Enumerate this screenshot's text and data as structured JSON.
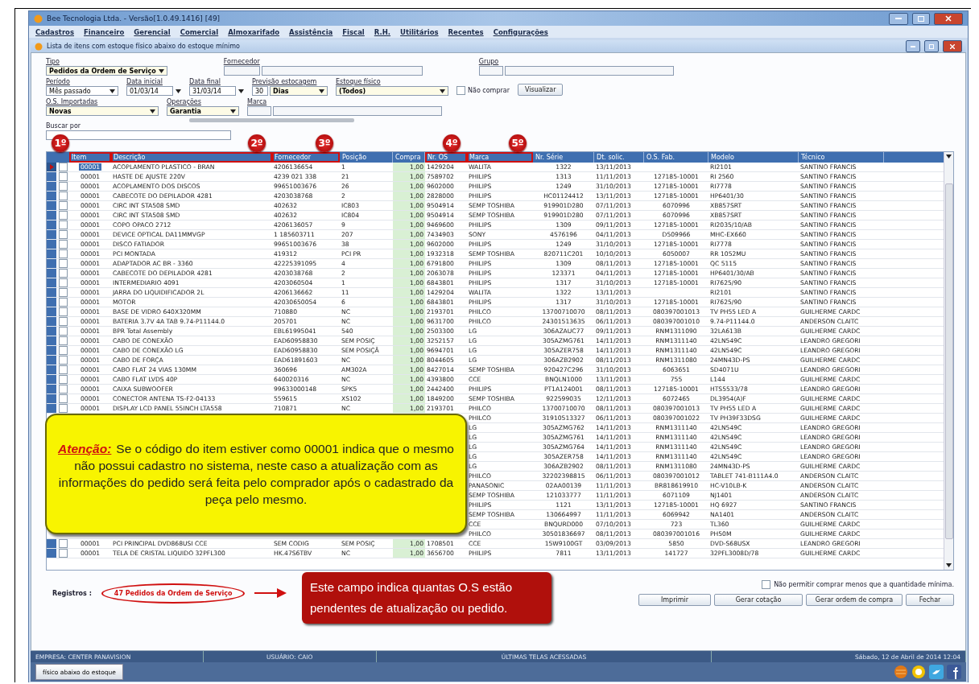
{
  "window": {
    "title": "Bee Tecnologia Ltda. - Versão[1.0.49.1416] [49]"
  },
  "menu": [
    "Cadastros",
    "Financeiro",
    "Gerencial",
    "Comercial",
    "Almoxarifado",
    "Assistência",
    "Fiscal",
    "R.H.",
    "Utilitários",
    "Recentes",
    "Configurações"
  ],
  "document": {
    "title": "Lista de itens com estoque físico abaixo do estoque mínimo"
  },
  "filter_rows": [
    [
      {
        "kind": "dropdown",
        "label": "Tipo",
        "value": "Pedidos da Ordem de Serviço",
        "highlighted": true
      },
      {
        "kind": "lookup",
        "label": "Fornecedor"
      },
      {
        "kind": "lookup",
        "label": "Grupo"
      }
    ],
    [
      {
        "kind": "dropdown",
        "label": "Período",
        "value": "Mês passado",
        "highlighted": false
      },
      {
        "kind": "date",
        "label": "Data inicial",
        "value": "01/03/14"
      },
      {
        "kind": "date",
        "label": "Data final",
        "value": "31/03/14"
      },
      {
        "kind": "number_unit",
        "label": "Previsão estocagem",
        "value": "30",
        "unit": "Dias"
      },
      {
        "kind": "dropdown",
        "label": "Estoque físico",
        "value": "(Todos)",
        "highlighted": true
      },
      {
        "kind": "checkbox",
        "label": "Não comprar",
        "checked": false
      },
      {
        "kind": "button",
        "label": "Visualizar"
      }
    ],
    [
      {
        "kind": "dropdown",
        "label": "O.S. Importadas",
        "value": "Novas",
        "highlighted": true
      },
      {
        "kind": "dropdown",
        "label": "Operações",
        "value": "Garantia",
        "highlighted": true
      },
      {
        "kind": "lookup",
        "label": "Marca"
      }
    ]
  ],
  "search": {
    "label": "Buscar por"
  },
  "table": {
    "columns": [
      {
        "label": "Item",
        "marker": "1º"
      },
      {
        "label": "Descrição",
        "marker": "2º"
      },
      {
        "label": "Fornecedor",
        "marker": "3º"
      },
      {
        "label": "Posição"
      },
      {
        "label": "Compra"
      },
      {
        "label": "Nr. OS",
        "marker": "4º"
      },
      {
        "label": "Marca",
        "marker": "5º"
      },
      {
        "label": "Nr. Série"
      },
      {
        "label": "Dt. solic."
      },
      {
        "label": "O.S. Fab."
      },
      {
        "label": "Modelo"
      },
      {
        "label": "Técnico"
      }
    ],
    "rows": [
      {
        "selected": true,
        "checked": false,
        "cells": [
          "00001",
          "ACOPLAMENTO PLASTICO - BRAN",
          "4206136654",
          "1",
          "1,00",
          "1429204",
          "WALITA",
          "1322",
          "13/11/2013",
          "",
          "RI2101",
          "SANTINO FRANCIS"
        ]
      },
      {
        "selected": false,
        "checked": false,
        "cells": [
          "00001",
          "HASTE DE AJUSTE 220V",
          "4239 021 338",
          "21",
          "1,00",
          "7589702",
          "PHILIPS",
          "1313",
          "11/11/2013",
          "127185-10001",
          "RI 2560",
          "SANTINO FRANCIS"
        ]
      },
      {
        "selected": false,
        "checked": false,
        "cells": [
          "00001",
          "ACOPLAMENTO DOS DISCOS",
          "99651003676",
          "26",
          "1,00",
          "9602000",
          "PHILIPS",
          "1249",
          "31/10/2013",
          "127185-10001",
          "RI7778",
          "SANTINO FRANCIS"
        ]
      },
      {
        "selected": false,
        "checked": false,
        "cells": [
          "00001",
          "CABECOTE DO DEPILADOR 4281",
          "4203038768",
          "2",
          "1,00",
          "2828000",
          "PHILIPS",
          "HC01124412",
          "13/11/2013",
          "127185-10001",
          "HP6401/30",
          "SANTINO FRANCIS"
        ]
      },
      {
        "selected": false,
        "checked": false,
        "cells": [
          "00001",
          "CIRC INT STA508 SMD",
          "402632",
          "IC803",
          "1,00",
          "9504914",
          "SEMP TOSHIBA",
          "919901D280",
          "07/11/2013",
          "6070996",
          "XB857SRT",
          "SANTINO FRANCIS"
        ]
      },
      {
        "selected": false,
        "checked": false,
        "cells": [
          "00001",
          "CIRC INT STA508 SMD",
          "402632",
          "IC804",
          "1,00",
          "9504914",
          "SEMP TOSHIBA",
          "919901D280",
          "07/11/2013",
          "6070996",
          "XB857SRT",
          "SANTINO FRANCIS"
        ]
      },
      {
        "selected": false,
        "checked": false,
        "cells": [
          "00001",
          "COPO OPACO 2712",
          "4206136057",
          "9",
          "1,00",
          "9469600",
          "PHILIPS",
          "1309",
          "09/11/2013",
          "127185-10001",
          "RI2035/10/AB",
          "SANTINO FRANCIS"
        ]
      },
      {
        "selected": false,
        "checked": false,
        "cells": [
          "00001",
          "DEVICE OPTICAL DA11MMVGP",
          "1 185603711",
          "207",
          "1,00",
          "7434903",
          "SONY",
          "4576196",
          "04/11/2013",
          "D509966",
          "MHC-EX660",
          "SANTINO FRANCIS"
        ]
      },
      {
        "selected": false,
        "checked": false,
        "cells": [
          "00001",
          "DISCO FATIADOR",
          "99651003676",
          "38",
          "1,00",
          "9602000",
          "PHILIPS",
          "1249",
          "31/10/2013",
          "127185-10001",
          "RI7778",
          "SANTINO FRANCIS"
        ]
      },
      {
        "selected": false,
        "checked": false,
        "cells": [
          "00001",
          "PCI MONTADA",
          "419312",
          "PCI PR",
          "1,00",
          "1932318",
          "SEMP TOSHIBA",
          "820711C201",
          "10/10/2013",
          "6050007",
          "RR 1052MU",
          "SANTINO FRANCIS"
        ]
      },
      {
        "selected": false,
        "checked": false,
        "cells": [
          "00001",
          "ADAPTADOR AC BR - 3360",
          "42225391095",
          "4",
          "1,00",
          "6791800",
          "PHILIPS",
          "1309",
          "08/11/2013",
          "127185-10001",
          "QC 5115",
          "SANTINO FRANCIS"
        ]
      },
      {
        "selected": false,
        "checked": false,
        "cells": [
          "00001",
          "CABECOTE DO DEPILADOR 4281",
          "4203038768",
          "2",
          "1,00",
          "2063078",
          "PHILIPS",
          "123371",
          "04/11/2013",
          "127185-10001",
          "HP6401/30/AB",
          "SANTINO FRANCIS"
        ]
      },
      {
        "selected": false,
        "checked": false,
        "cells": [
          "00001",
          "INTERMEDIARIO 4091",
          "4203060504",
          "1",
          "1,00",
          "6843801",
          "PHILIPS",
          "1317",
          "31/10/2013",
          "127185-10001",
          "RI7625/90",
          "SANTINO FRANCIS"
        ]
      },
      {
        "selected": false,
        "checked": false,
        "cells": [
          "00001",
          "JARRA DO LIQUIDIFICADOR 2L",
          "4206136662",
          "11",
          "1,00",
          "1429204",
          "WALITA",
          "1322",
          "13/11/2013",
          "",
          "RI2101",
          "SANTINO FRANCIS"
        ]
      },
      {
        "selected": false,
        "checked": false,
        "cells": [
          "00001",
          "MOTOR",
          "42030650054",
          "6",
          "1,00",
          "6843801",
          "PHILIPS",
          "1317",
          "31/10/2013",
          "127185-10001",
          "RI7625/90",
          "SANTINO FRANCIS"
        ]
      },
      {
        "selected": false,
        "checked": false,
        "cells": [
          "00001",
          "BASE DE VIDRO 640X320MM",
          "710880",
          "NC",
          "1,00",
          "2193701",
          "PHILCO",
          "13700710070",
          "08/11/2013",
          "080397001013",
          "TV PH55 LED A",
          "GUILHERME CARDC"
        ]
      },
      {
        "selected": false,
        "checked": false,
        "cells": [
          "00001",
          "BATERIA 3.7V 4A TAB 9.74-P11144.0",
          "205701",
          "NC",
          "1,00",
          "9631700",
          "PHILCO",
          "24301513635",
          "06/11/2013",
          "080397001010",
          "9.74-P11144.0",
          "ANDERSON CLAITC"
        ]
      },
      {
        "selected": false,
        "checked": false,
        "cells": [
          "00001",
          "BPR Total Assembly",
          "EBL61995041",
          "540",
          "1,00",
          "2503300",
          "LG",
          "306AZAUC77",
          "09/11/2013",
          "RNM1311090",
          "32LA613B",
          "GUILHERME CARDC"
        ]
      },
      {
        "selected": false,
        "checked": false,
        "cells": [
          "00001",
          "CABO DE CONEXÃO",
          "EAD60958830",
          "SEM POSIÇ",
          "1,00",
          "3252157",
          "LG",
          "305AZMG761",
          "14/11/2013",
          "RNM1311140",
          "42LN549C",
          "LEANDRO GREGORI"
        ]
      },
      {
        "selected": false,
        "checked": false,
        "cells": [
          "00001",
          "CABO DE CONEXÃO LG",
          "EAD60958830",
          "SEM POSIÇÃ",
          "1,00",
          "9694701",
          "LG",
          "305AZER758",
          "14/11/2013",
          "RNM1311140",
          "42LN549C",
          "LEANDRO GREGORI"
        ]
      },
      {
        "selected": false,
        "checked": false,
        "cells": [
          "00001",
          "CABO DE FORÇA",
          "EAD61891603",
          "NC",
          "1,00",
          "8044605",
          "LG",
          "306AZB2902",
          "08/11/2013",
          "RNM1311080",
          "24MN43D-PS",
          "GUILHERME CARDC"
        ]
      },
      {
        "selected": false,
        "checked": false,
        "cells": [
          "00001",
          "CABO FLAT 24 VIAS 130MM",
          "360696",
          "AM302A",
          "1,00",
          "8427014",
          "SEMP TOSHIBA",
          "920427C296",
          "31/10/2013",
          "6063651",
          "SD4071U",
          "LEANDRO GREGORI"
        ]
      },
      {
        "selected": false,
        "checked": false,
        "cells": [
          "00001",
          "CABO FLAT LVDS 40P",
          "640020316",
          "NC",
          "1,00",
          "4393800",
          "CCE",
          "BNQLN1000",
          "13/11/2013",
          "755",
          "L144",
          "GUILHERME CARDC"
        ]
      },
      {
        "selected": false,
        "checked": false,
        "cells": [
          "00001",
          "CAIXA SUBWOOFER",
          "99633000148",
          "SPK5",
          "1,00",
          "2442400",
          "PHILIPS",
          "PT1A124001",
          "08/11/2013",
          "127185-10001",
          "HTS5533/78",
          "LEANDRO GREGORI"
        ]
      },
      {
        "selected": false,
        "checked": false,
        "cells": [
          "00001",
          "CONECTOR ANTENA TS-F2-04133",
          "559615",
          "XS102",
          "1,00",
          "1849200",
          "SEMP TOSHIBA",
          "922599035",
          "12/11/2013",
          "6072465",
          "DL3954(A)F",
          "GUILHERME CARDC"
        ]
      },
      {
        "selected": false,
        "checked": false,
        "cells": [
          "00001",
          "DISPLAY LCD PANEL 55INCH LTA558",
          "710871",
          "NC",
          "1,00",
          "2193701",
          "PHILCO",
          "13700710070",
          "08/11/2013",
          "080397001013",
          "TV PH55 LED A",
          "GUILHERME CARDC"
        ]
      },
      {
        "cells": [
          "PHILCO",
          "31910513327",
          "06/11/2013",
          "080397001022",
          "TV PH39F33DSG",
          "GUILHERME CARDC"
        ]
      },
      {
        "cells": [
          "LG",
          "305AZMG762",
          "14/11/2013",
          "RNM1311140",
          "42LN549C",
          "LEANDRO GREGORI"
        ]
      },
      {
        "cells": [
          "LG",
          "305AZMG761",
          "14/11/2013",
          "RNM1311140",
          "42LN549C",
          "LEANDRO GREGORI"
        ]
      },
      {
        "cells": [
          "LG",
          "305AZMG764",
          "14/11/2013",
          "RNM1311140",
          "42LN549C",
          "LEANDRO GREGORI"
        ]
      },
      {
        "cells": [
          "LG",
          "305AZER758",
          "14/11/2013",
          "RNM1311140",
          "42LN549C",
          "LEANDRO GREGORI"
        ]
      },
      {
        "cells": [
          "LG",
          "306AZB2902",
          "08/11/2013",
          "RNM1311080",
          "24MN43D-PS",
          "GUILHERME CARDC"
        ]
      },
      {
        "cells": [
          "PHILCO",
          "32202398815",
          "06/11/2013",
          "080397001012",
          "TABLET 741-B111A4.0",
          "ANDERSON CLAITC"
        ]
      },
      {
        "cells": [
          "PANASONIC",
          "02AA00139",
          "11/11/2013",
          "BR818619910",
          "HC-V10LB-K",
          "ANDERSON CLAITC"
        ]
      },
      {
        "cells": [
          "SEMP TOSHIBA",
          "121033777",
          "11/11/2013",
          "6071109",
          "NJ1401",
          "ANDERSON CLAITC"
        ]
      },
      {
        "cells": [
          "PHILIPS",
          "1121",
          "13/11/2013",
          "127185-10001",
          "HQ 6927",
          "SANTINO FRANCIS"
        ]
      },
      {
        "cells": [
          "SEMP TOSHIBA",
          "130664997",
          "11/11/2013",
          "6069942",
          "NA1401",
          "ANDERSON CLAITC"
        ]
      },
      {
        "cells": [
          "CCE",
          "BNQURD000",
          "07/10/2013",
          "723",
          "TL360",
          "GUILHERME CARDC"
        ]
      },
      {
        "cells": [
          "PHILCO",
          "30501836697",
          "08/11/2013",
          "080397001016",
          "PH50M",
          "GUILHERME CARDC"
        ]
      },
      {
        "selected": false,
        "checked": false,
        "cells": [
          "00001",
          "PCI PRINCIPAL DVD868USI CCE",
          "SEM CODIG",
          "SEM POSIÇ",
          "1,00",
          "1708501",
          "CCE",
          "15W9100GT",
          "03/09/2013",
          "5850",
          "DVD-S68USX",
          "LEANDRO GREGORI"
        ]
      },
      {
        "selected": false,
        "checked": false,
        "cells": [
          "00001",
          "TELA DE CRISTAL LIQUIDO 32PFL300",
          "HK.47S6TBV",
          "NC",
          "1,00",
          "3656700",
          "PHILIPS",
          "7811",
          "13/11/2013",
          "141727",
          "32PFL3008D/78",
          "GUILHERME CARDC"
        ]
      }
    ]
  },
  "callout": {
    "label": "Atenção:",
    "text": "Se o código do item estiver como 00001 indica que o mesmo não possui cadastro no sistema, neste caso a atualização com as informações do pedido será feita pelo comprador após o cadastrado da peça pelo mesmo."
  },
  "records": {
    "label": "Registros :",
    "value": "47 Pedidos da Ordem de Serviço"
  },
  "note": {
    "text": "Este campo indica quantas O.S estão pendentes de atualização ou pedido."
  },
  "min_quantity": {
    "label": "Não permitir comprar menos que a quantidade mínima.",
    "checked": false
  },
  "buttons": [
    "Imprimir",
    "Gerar cotação",
    "Gerar ordem de compra",
    "Fechar"
  ],
  "status_bar": [
    "EMPRESA: CENTER PANAVISION",
    "USUÁRIO: CAIO",
    "ÚLTIMAS TELAS ACESSADAS",
    "Sábado, 12 de Abril de 2014 12:04"
  ],
  "taskbar": {
    "button": "físico abaixo do estoque"
  }
}
